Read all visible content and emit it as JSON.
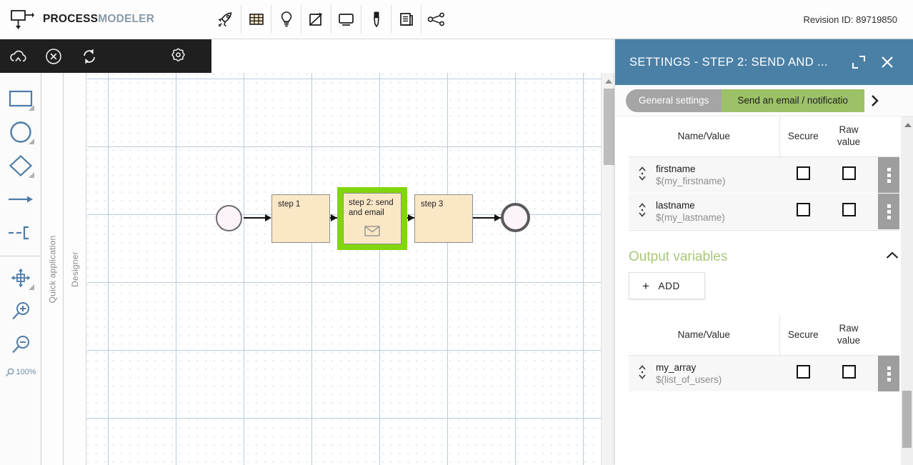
{
  "app": {
    "brand_primary": "PROCESS",
    "brand_secondary": "MODELER",
    "logo_icon": "process-flow-logo-icon",
    "revision_label": "Revision ID: 89719850"
  },
  "toolbar": {
    "items": [
      {
        "name": "rocket-icon",
        "label": "Deploy"
      },
      {
        "name": "grid-table-icon",
        "label": "Data table"
      },
      {
        "name": "lightbulb-icon",
        "label": "Ideas"
      },
      {
        "name": "pdf-export-icon",
        "label": "Export PDF"
      },
      {
        "name": "monitor-icon",
        "label": "Preview"
      },
      {
        "name": "marker-pen-icon",
        "label": "Annotate"
      },
      {
        "name": "document-icon",
        "label": "Documentation"
      },
      {
        "name": "share-nodes-icon",
        "label": "Share"
      }
    ]
  },
  "dark_toolbar": {
    "items": [
      {
        "name": "cloud-upload-icon",
        "label": "Publish"
      },
      {
        "name": "cancel-circle-icon",
        "label": "Cancel"
      },
      {
        "name": "refresh-sync-icon",
        "label": "Refresh"
      },
      {
        "name": "gear-icon",
        "label": "Settings"
      }
    ]
  },
  "shape_toolbar": {
    "items": [
      {
        "name": "rectangle-shape-tool",
        "label": "Rectangle"
      },
      {
        "name": "circle-shape-tool",
        "label": "Circle"
      },
      {
        "name": "diamond-shape-tool",
        "label": "Diamond"
      },
      {
        "name": "arrow-connector-tool",
        "label": "Arrow"
      },
      {
        "name": "boundary-connector-tool",
        "label": "Boundary"
      },
      {
        "name": "pan-move-tool",
        "label": "Pan"
      },
      {
        "name": "zoom-in-tool",
        "label": "Zoom in"
      },
      {
        "name": "zoom-out-tool",
        "label": "Zoom out"
      }
    ],
    "zoom_level": "100%"
  },
  "vertical_tabs": [
    {
      "label": "Quick application"
    },
    {
      "label": "Designer"
    }
  ],
  "diagram": {
    "start_event": {
      "name": "start-event"
    },
    "end_event": {
      "name": "end-event"
    },
    "tasks": [
      {
        "label": "step 1"
      },
      {
        "label": "step 2: send and email",
        "selected": true,
        "icon": "envelope-icon"
      },
      {
        "label": "step 3"
      }
    ]
  },
  "panel": {
    "title": "SETTINGS  - STEP 2: SEND AND ...",
    "expand_icon": "expand-icon",
    "close_icon": "close-icon",
    "tabs": [
      {
        "label": "General settings",
        "active": false
      },
      {
        "label": "Send an email / notificatio",
        "active": true
      }
    ],
    "tabs_next_icon": "chevron-right-icon",
    "input_table": {
      "columns": [
        "Name/Value",
        "Secure",
        "Raw value"
      ],
      "rows": [
        {
          "name": "firstname",
          "value": "$(my_firstname)",
          "secure": false,
          "raw_value": false
        },
        {
          "name": "lastname",
          "value": "$(my_lastname)",
          "secure": false,
          "raw_value": false
        }
      ]
    },
    "output_section": {
      "title": "Output variables",
      "collapse_icon": "chevron-up-icon",
      "add_label": "ADD",
      "add_plus": "+",
      "table": {
        "columns": [
          "Name/Value",
          "Secure",
          "Raw value"
        ],
        "rows": [
          {
            "name": "my_array",
            "value": "$(list_of_users)",
            "secure": false,
            "raw_value": false
          }
        ]
      }
    }
  },
  "colors": {
    "panel_header": "#4a80a6",
    "tab_active": "#9cc167",
    "tab_inactive": "#a5a5a5",
    "section_title": "#a7c879",
    "task_fill": "#fae7c6",
    "selection": "#82d60f"
  }
}
